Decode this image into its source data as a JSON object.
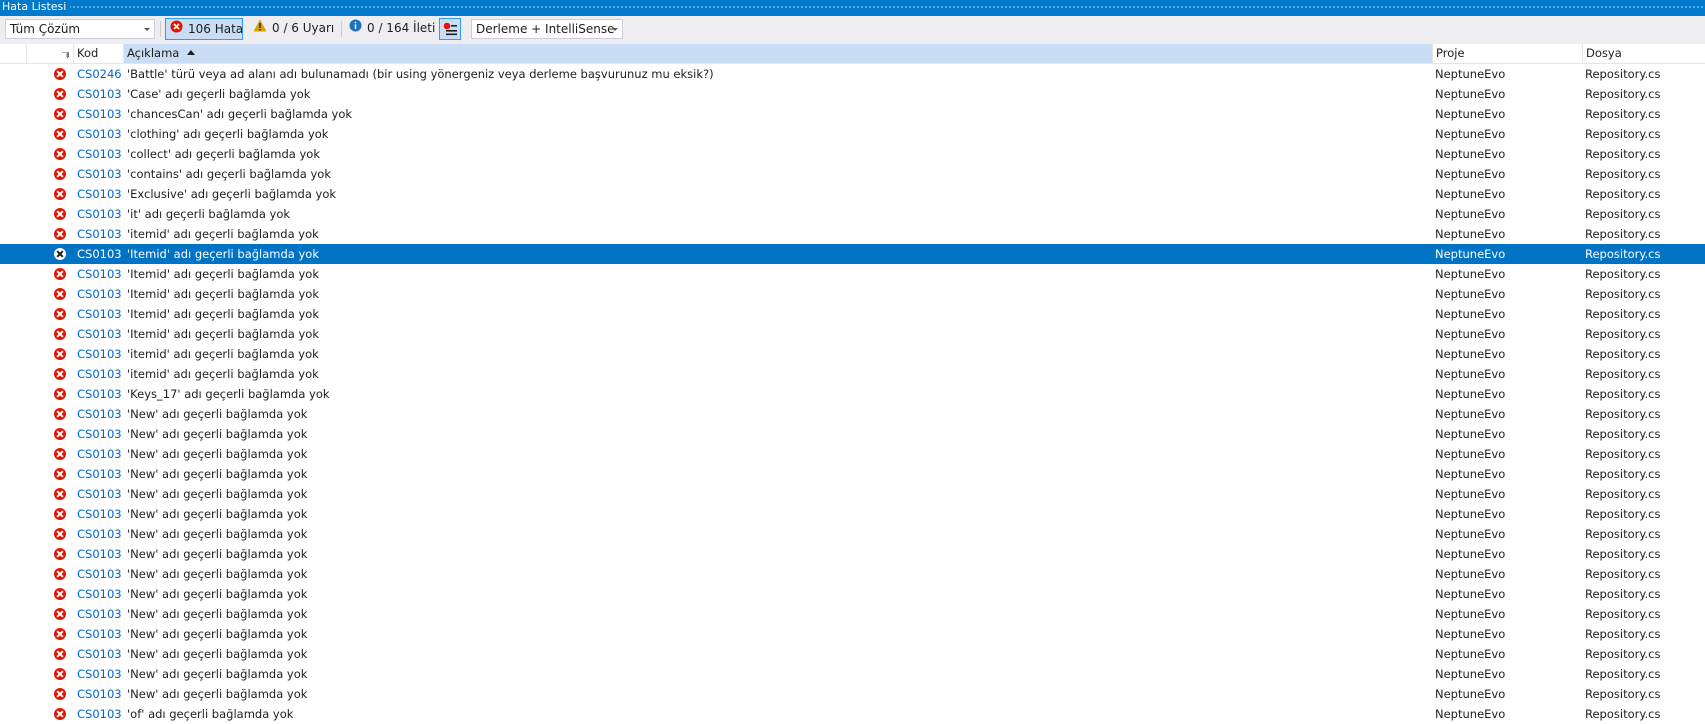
{
  "window": {
    "title": "Hata Listesi"
  },
  "toolbar": {
    "scope_value": "Tüm Çözüm",
    "errors_label": "106 Hata",
    "warnings_label": "0 / 6 Uyarı",
    "messages_label": "0 / 164 İleti",
    "build_source_value": "Derleme + IntelliSense"
  },
  "columns": {
    "code": "Kod",
    "description": "Açıklama",
    "project": "Proje",
    "file": "Dosya"
  },
  "colors": {
    "accent": "#007acc",
    "selection": "#0073c4",
    "error": "#e51400",
    "link": "#0066cc"
  },
  "rows": [
    {
      "code": "CS0246",
      "description": "'Battle' türü veya ad alanı adı bulunamadı (bir using yönergeniz veya derleme başvurunuz mu eksik?)",
      "project": "NeptuneEvo",
      "file": "Repository.cs"
    },
    {
      "code": "CS0103",
      "description": "'Case' adı geçerli bağlamda yok",
      "project": "NeptuneEvo",
      "file": "Repository.cs"
    },
    {
      "code": "CS0103",
      "description": "'chancesCan' adı geçerli bağlamda yok",
      "project": "NeptuneEvo",
      "file": "Repository.cs"
    },
    {
      "code": "CS0103",
      "description": "'clothing' adı geçerli bağlamda yok",
      "project": "NeptuneEvo",
      "file": "Repository.cs"
    },
    {
      "code": "CS0103",
      "description": "'collect' adı geçerli bağlamda yok",
      "project": "NeptuneEvo",
      "file": "Repository.cs"
    },
    {
      "code": "CS0103",
      "description": "'contains' adı geçerli bağlamda yok",
      "project": "NeptuneEvo",
      "file": "Repository.cs"
    },
    {
      "code": "CS0103",
      "description": "'Exclusive' adı geçerli bağlamda yok",
      "project": "NeptuneEvo",
      "file": "Repository.cs"
    },
    {
      "code": "CS0103",
      "description": "'it' adı geçerli bağlamda yok",
      "project": "NeptuneEvo",
      "file": "Repository.cs"
    },
    {
      "code": "CS0103",
      "description": "'itemid' adı geçerli bağlamda yok",
      "project": "NeptuneEvo",
      "file": "Repository.cs"
    },
    {
      "code": "CS0103",
      "description": "'Itemid' adı geçerli bağlamda yok",
      "project": "NeptuneEvo",
      "file": "Repository.cs",
      "selected": true
    },
    {
      "code": "CS0103",
      "description": "'Itemid' adı geçerli bağlamda yok",
      "project": "NeptuneEvo",
      "file": "Repository.cs"
    },
    {
      "code": "CS0103",
      "description": "'Itemid' adı geçerli bağlamda yok",
      "project": "NeptuneEvo",
      "file": "Repository.cs"
    },
    {
      "code": "CS0103",
      "description": "'Itemid' adı geçerli bağlamda yok",
      "project": "NeptuneEvo",
      "file": "Repository.cs"
    },
    {
      "code": "CS0103",
      "description": "'Itemid' adı geçerli bağlamda yok",
      "project": "NeptuneEvo",
      "file": "Repository.cs"
    },
    {
      "code": "CS0103",
      "description": "'itemid' adı geçerli bağlamda yok",
      "project": "NeptuneEvo",
      "file": "Repository.cs"
    },
    {
      "code": "CS0103",
      "description": "'itemid' adı geçerli bağlamda yok",
      "project": "NeptuneEvo",
      "file": "Repository.cs"
    },
    {
      "code": "CS0103",
      "description": "'Keys_17' adı geçerli bağlamda yok",
      "project": "NeptuneEvo",
      "file": "Repository.cs"
    },
    {
      "code": "CS0103",
      "description": "'New' adı geçerli bağlamda yok",
      "project": "NeptuneEvo",
      "file": "Repository.cs"
    },
    {
      "code": "CS0103",
      "description": "'New' adı geçerli bağlamda yok",
      "project": "NeptuneEvo",
      "file": "Repository.cs"
    },
    {
      "code": "CS0103",
      "description": "'New' adı geçerli bağlamda yok",
      "project": "NeptuneEvo",
      "file": "Repository.cs"
    },
    {
      "code": "CS0103",
      "description": "'New' adı geçerli bağlamda yok",
      "project": "NeptuneEvo",
      "file": "Repository.cs"
    },
    {
      "code": "CS0103",
      "description": "'New' adı geçerli bağlamda yok",
      "project": "NeptuneEvo",
      "file": "Repository.cs"
    },
    {
      "code": "CS0103",
      "description": "'New' adı geçerli bağlamda yok",
      "project": "NeptuneEvo",
      "file": "Repository.cs"
    },
    {
      "code": "CS0103",
      "description": "'New' adı geçerli bağlamda yok",
      "project": "NeptuneEvo",
      "file": "Repository.cs"
    },
    {
      "code": "CS0103",
      "description": "'New' adı geçerli bağlamda yok",
      "project": "NeptuneEvo",
      "file": "Repository.cs"
    },
    {
      "code": "CS0103",
      "description": "'New' adı geçerli bağlamda yok",
      "project": "NeptuneEvo",
      "file": "Repository.cs"
    },
    {
      "code": "CS0103",
      "description": "'New' adı geçerli bağlamda yok",
      "project": "NeptuneEvo",
      "file": "Repository.cs"
    },
    {
      "code": "CS0103",
      "description": "'New' adı geçerli bağlamda yok",
      "project": "NeptuneEvo",
      "file": "Repository.cs"
    },
    {
      "code": "CS0103",
      "description": "'New' adı geçerli bağlamda yok",
      "project": "NeptuneEvo",
      "file": "Repository.cs"
    },
    {
      "code": "CS0103",
      "description": "'New' adı geçerli bağlamda yok",
      "project": "NeptuneEvo",
      "file": "Repository.cs"
    },
    {
      "code": "CS0103",
      "description": "'New' adı geçerli bağlamda yok",
      "project": "NeptuneEvo",
      "file": "Repository.cs"
    },
    {
      "code": "CS0103",
      "description": "'New' adı geçerli bağlamda yok",
      "project": "NeptuneEvo",
      "file": "Repository.cs"
    },
    {
      "code": "CS0103",
      "description": "'of' adı geçerli bağlamda yok",
      "project": "NeptuneEvo",
      "file": "Repository.cs"
    }
  ]
}
